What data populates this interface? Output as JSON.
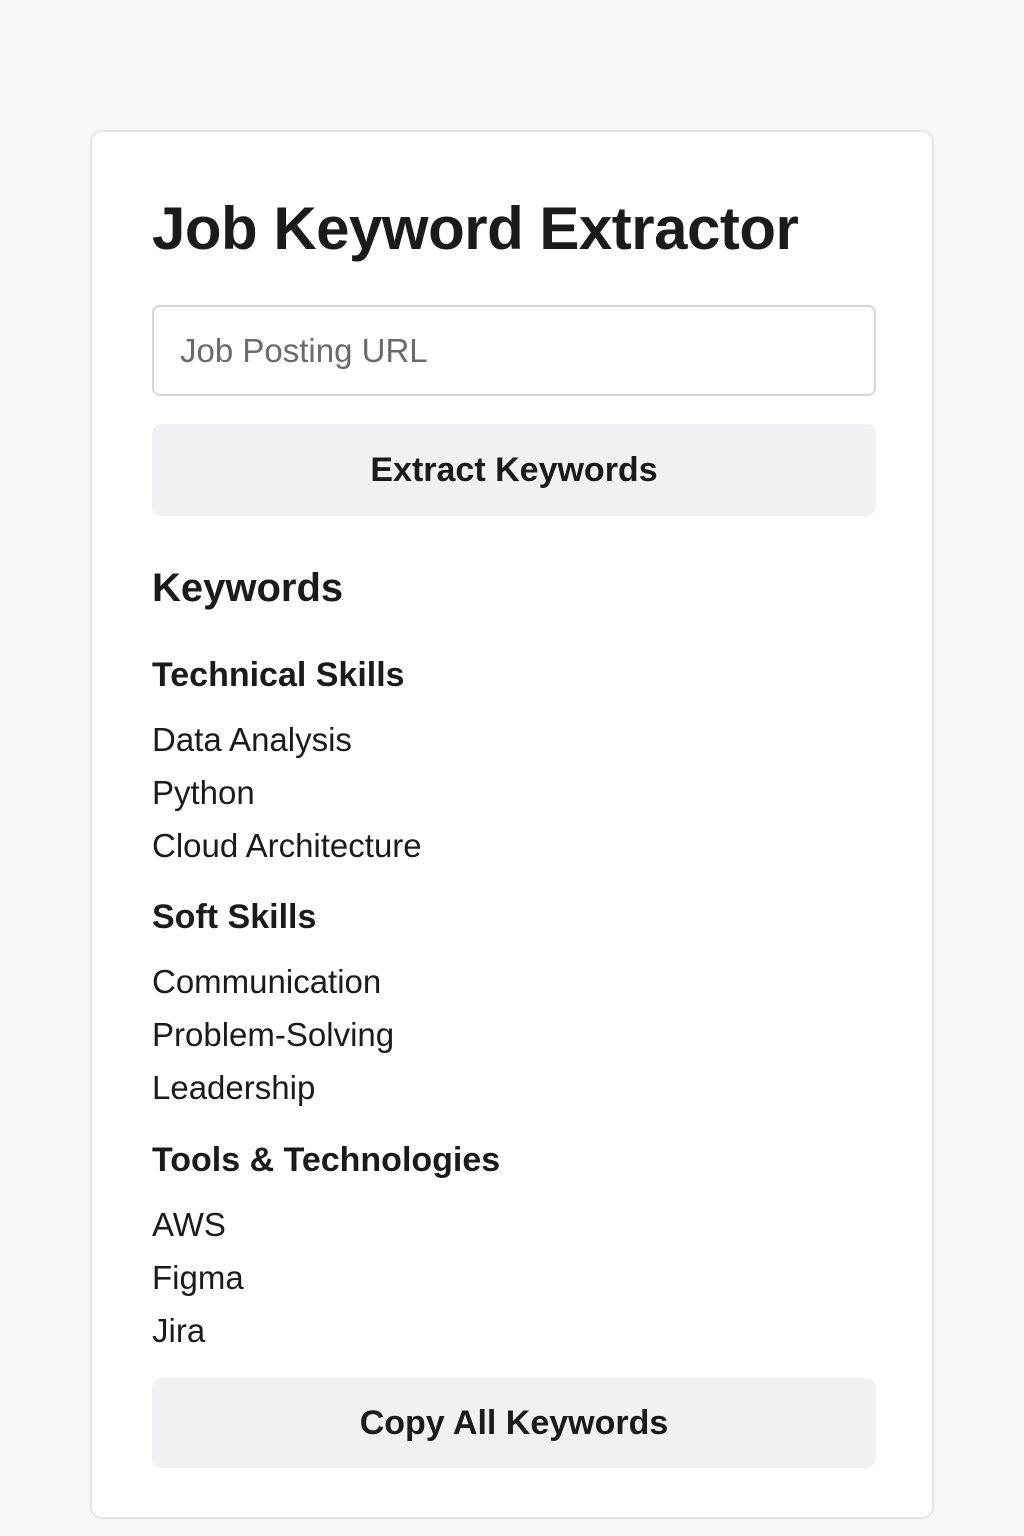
{
  "app": {
    "title": "Job Keyword Extractor"
  },
  "form": {
    "url_placeholder": "Job Posting URL",
    "url_value": "",
    "extract_label": "Extract Keywords"
  },
  "results": {
    "heading": "Keywords",
    "groups": [
      {
        "title": "Technical Skills",
        "items": [
          "Data Analysis",
          "Python",
          "Cloud Architecture"
        ]
      },
      {
        "title": "Soft Skills",
        "items": [
          "Communication",
          "Problem-Solving",
          "Leadership"
        ]
      },
      {
        "title": "Tools & Technologies",
        "items": [
          "AWS",
          "Figma",
          "Jira"
        ]
      }
    ],
    "copy_label": "Copy All Keywords"
  },
  "colors": {
    "page_background": "#f7f7f7",
    "card_background": "#ffffff",
    "button_background": "#f1f1f3",
    "text": "#1b1b1b"
  }
}
